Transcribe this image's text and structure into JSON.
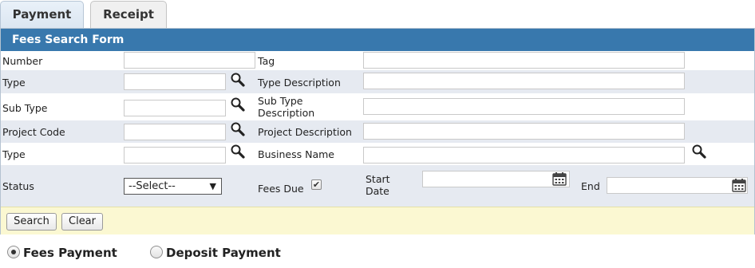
{
  "tabs": {
    "payment": "Payment",
    "receipt": "Receipt"
  },
  "form": {
    "title": "Fees Search Form",
    "labels": {
      "number": "Number",
      "tag": "Tag",
      "type": "Type",
      "type_description": "Type Description",
      "sub_type": "Sub Type",
      "sub_type_description": "Sub Type Description",
      "project_code": "Project Code",
      "project_description": "Project Description",
      "type2": "Type",
      "business_name": "Business Name",
      "status": "Status",
      "fees_due": "Fees Due",
      "start_date": "Start Date",
      "end": "End"
    },
    "status_selected": "--Select--",
    "fees_due_checked": "✔",
    "buttons": {
      "search": "Search",
      "clear": "Clear"
    }
  },
  "payment_options": {
    "fees_payment": "Fees Payment",
    "deposit_payment": "Deposit Payment"
  },
  "colors": {
    "header_bg": "#3878ad",
    "alt_row": "#e6eaf1",
    "button_bar": "#fbf8d2"
  },
  "icons": [
    "search-icon",
    "calendar-icon",
    "checkbox-check-icon",
    "dropdown-arrow-icon"
  ]
}
